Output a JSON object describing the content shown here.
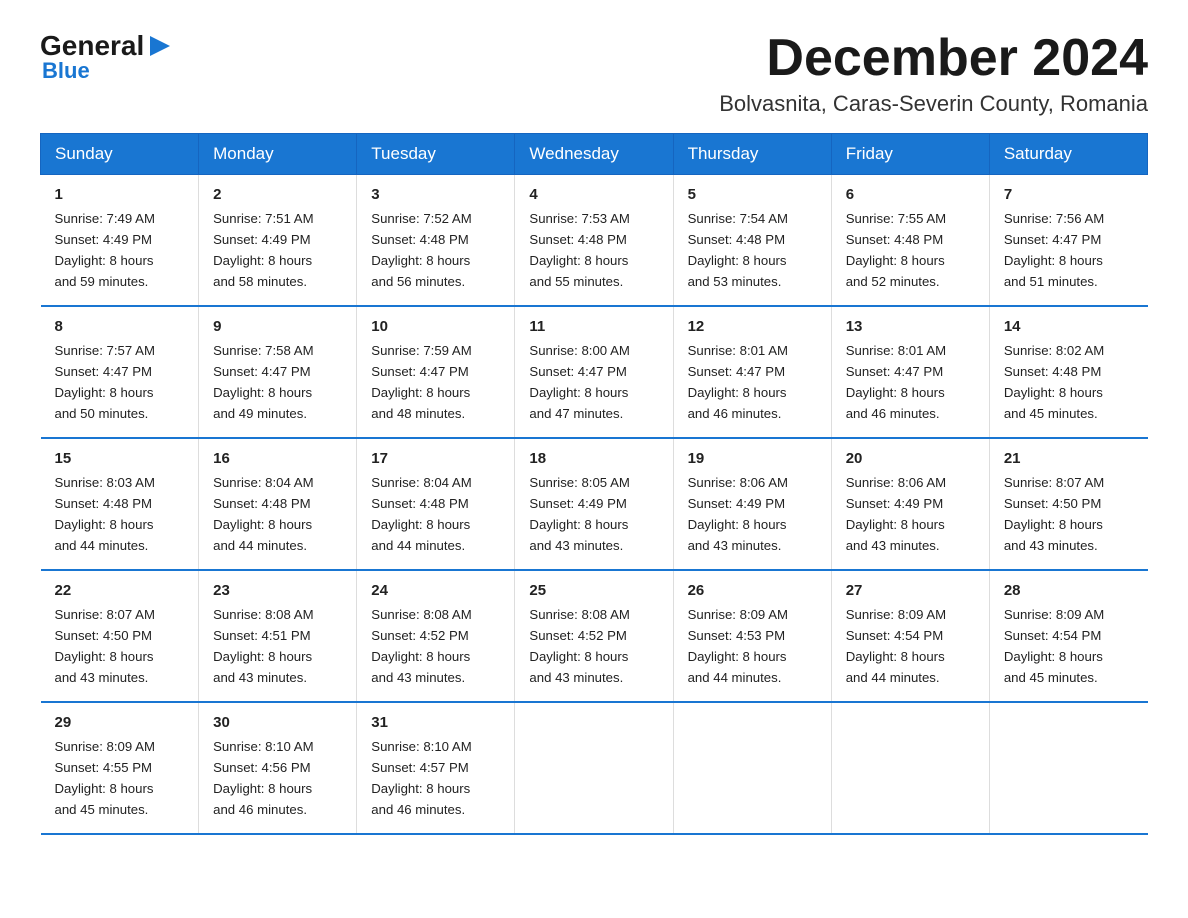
{
  "logo": {
    "general": "General",
    "blue": "Blue"
  },
  "header": {
    "month_title": "December 2024",
    "location": "Bolvasnita, Caras-Severin County, Romania"
  },
  "days_of_week": [
    "Sunday",
    "Monday",
    "Tuesday",
    "Wednesday",
    "Thursday",
    "Friday",
    "Saturday"
  ],
  "weeks": [
    [
      {
        "day": "1",
        "sunrise": "7:49 AM",
        "sunset": "4:49 PM",
        "daylight": "8 hours and 59 minutes."
      },
      {
        "day": "2",
        "sunrise": "7:51 AM",
        "sunset": "4:49 PM",
        "daylight": "8 hours and 58 minutes."
      },
      {
        "day": "3",
        "sunrise": "7:52 AM",
        "sunset": "4:48 PM",
        "daylight": "8 hours and 56 minutes."
      },
      {
        "day": "4",
        "sunrise": "7:53 AM",
        "sunset": "4:48 PM",
        "daylight": "8 hours and 55 minutes."
      },
      {
        "day": "5",
        "sunrise": "7:54 AM",
        "sunset": "4:48 PM",
        "daylight": "8 hours and 53 minutes."
      },
      {
        "day": "6",
        "sunrise": "7:55 AM",
        "sunset": "4:48 PM",
        "daylight": "8 hours and 52 minutes."
      },
      {
        "day": "7",
        "sunrise": "7:56 AM",
        "sunset": "4:47 PM",
        "daylight": "8 hours and 51 minutes."
      }
    ],
    [
      {
        "day": "8",
        "sunrise": "7:57 AM",
        "sunset": "4:47 PM",
        "daylight": "8 hours and 50 minutes."
      },
      {
        "day": "9",
        "sunrise": "7:58 AM",
        "sunset": "4:47 PM",
        "daylight": "8 hours and 49 minutes."
      },
      {
        "day": "10",
        "sunrise": "7:59 AM",
        "sunset": "4:47 PM",
        "daylight": "8 hours and 48 minutes."
      },
      {
        "day": "11",
        "sunrise": "8:00 AM",
        "sunset": "4:47 PM",
        "daylight": "8 hours and 47 minutes."
      },
      {
        "day": "12",
        "sunrise": "8:01 AM",
        "sunset": "4:47 PM",
        "daylight": "8 hours and 46 minutes."
      },
      {
        "day": "13",
        "sunrise": "8:01 AM",
        "sunset": "4:47 PM",
        "daylight": "8 hours and 46 minutes."
      },
      {
        "day": "14",
        "sunrise": "8:02 AM",
        "sunset": "4:48 PM",
        "daylight": "8 hours and 45 minutes."
      }
    ],
    [
      {
        "day": "15",
        "sunrise": "8:03 AM",
        "sunset": "4:48 PM",
        "daylight": "8 hours and 44 minutes."
      },
      {
        "day": "16",
        "sunrise": "8:04 AM",
        "sunset": "4:48 PM",
        "daylight": "8 hours and 44 minutes."
      },
      {
        "day": "17",
        "sunrise": "8:04 AM",
        "sunset": "4:48 PM",
        "daylight": "8 hours and 44 minutes."
      },
      {
        "day": "18",
        "sunrise": "8:05 AM",
        "sunset": "4:49 PM",
        "daylight": "8 hours and 43 minutes."
      },
      {
        "day": "19",
        "sunrise": "8:06 AM",
        "sunset": "4:49 PM",
        "daylight": "8 hours and 43 minutes."
      },
      {
        "day": "20",
        "sunrise": "8:06 AM",
        "sunset": "4:49 PM",
        "daylight": "8 hours and 43 minutes."
      },
      {
        "day": "21",
        "sunrise": "8:07 AM",
        "sunset": "4:50 PM",
        "daylight": "8 hours and 43 minutes."
      }
    ],
    [
      {
        "day": "22",
        "sunrise": "8:07 AM",
        "sunset": "4:50 PM",
        "daylight": "8 hours and 43 minutes."
      },
      {
        "day": "23",
        "sunrise": "8:08 AM",
        "sunset": "4:51 PM",
        "daylight": "8 hours and 43 minutes."
      },
      {
        "day": "24",
        "sunrise": "8:08 AM",
        "sunset": "4:52 PM",
        "daylight": "8 hours and 43 minutes."
      },
      {
        "day": "25",
        "sunrise": "8:08 AM",
        "sunset": "4:52 PM",
        "daylight": "8 hours and 43 minutes."
      },
      {
        "day": "26",
        "sunrise": "8:09 AM",
        "sunset": "4:53 PM",
        "daylight": "8 hours and 44 minutes."
      },
      {
        "day": "27",
        "sunrise": "8:09 AM",
        "sunset": "4:54 PM",
        "daylight": "8 hours and 44 minutes."
      },
      {
        "day": "28",
        "sunrise": "8:09 AM",
        "sunset": "4:54 PM",
        "daylight": "8 hours and 45 minutes."
      }
    ],
    [
      {
        "day": "29",
        "sunrise": "8:09 AM",
        "sunset": "4:55 PM",
        "daylight": "8 hours and 45 minutes."
      },
      {
        "day": "30",
        "sunrise": "8:10 AM",
        "sunset": "4:56 PM",
        "daylight": "8 hours and 46 minutes."
      },
      {
        "day": "31",
        "sunrise": "8:10 AM",
        "sunset": "4:57 PM",
        "daylight": "8 hours and 46 minutes."
      },
      null,
      null,
      null,
      null
    ]
  ],
  "labels": {
    "sunrise": "Sunrise:",
    "sunset": "Sunset:",
    "daylight": "Daylight:"
  }
}
